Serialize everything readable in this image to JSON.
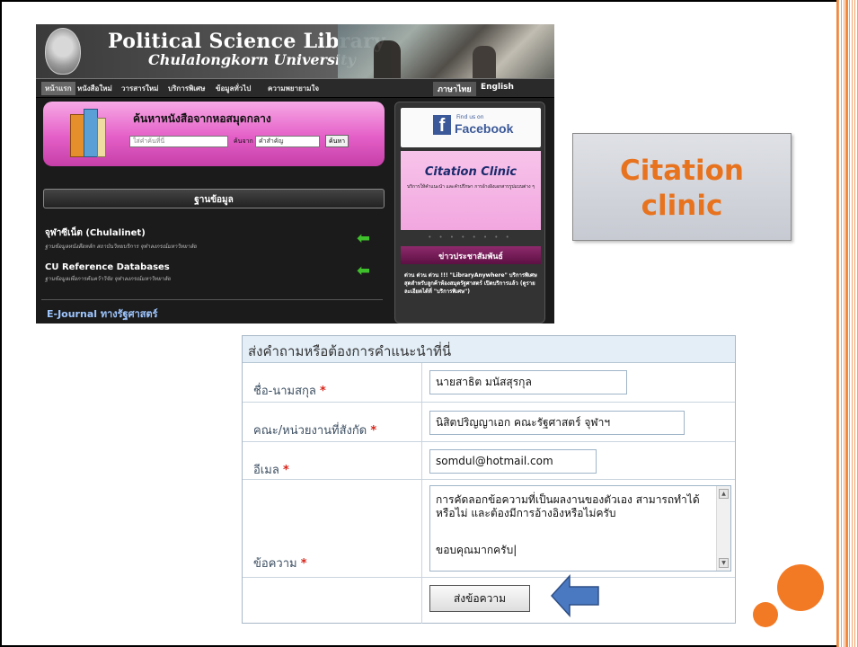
{
  "site": {
    "title": "Political Science Library",
    "subtitle": "Chulalongkorn University",
    "nav": [
      "หน้าแรก",
      "หนังสือใหม่",
      "วารสารใหม่",
      "บริการพิเศษ",
      "ข้อมูลทั่วไป",
      "ความพยายามใจ"
    ],
    "lang_thai": "ภาษาไทย",
    "lang_english": "English",
    "search": {
      "title": "ค้นหาหนังสือจากหอสมุดกลาง",
      "placeholder": "ใส่คำค้นที่นี่",
      "from_label": "ค้นจาก",
      "select_value": "คำสำคัญ",
      "button": "ค้นหา"
    },
    "database_heading": "ฐานข้อมูล",
    "db_items": [
      {
        "title": "จุฬาซีเน็ต (Chulalinet)",
        "desc": "ฐานข้อมูลหนังสือหลัก สถาบันวิทยบริการ จุฬาลงกรณ์มหาวิทยาลัย"
      },
      {
        "title": "CU Reference Databases",
        "desc": "ฐานข้อมูลเพื่อการค้นคว้าวิจัย จุฬาลงกรณ์มหาวิทยาลัย"
      }
    ],
    "ejournal": "E-Journal ทางรัฐศาสตร์",
    "facebook": {
      "find": "Find us on",
      "name": "Facebook"
    },
    "citation_banner": {
      "title": "Citation Clinic",
      "desc": "บริการให้คำแนะนำ และคำปรึกษา การอ้างอิงเอกสารรูปแบบต่าง ๆ"
    },
    "news_heading": "ข่าวประชาสัมพันธ์",
    "news_text": "ด่วน ด่วน ด่วน !!! \"LibraryAnywhere\" บริการพิเศษ สุดสำหรับลูกค้าห้องสมุดรัฐศาสตร์ เปิดบริการแล้ว (ดูรายละเอียดได้ที่ \"บริการพิเศษ\")"
  },
  "callout": {
    "line1": "Citation",
    "line2": "clinic"
  },
  "form": {
    "heading": "ส่งคำถามหรือต้องการคำแนะนำที่นี่",
    "name_label": "ชื่อ-นามสกุล",
    "name_value": "นายสาธิต มนัสสุรกุล",
    "faculty_label": "คณะ/หน่วยงานที่สังกัด",
    "faculty_value": "นิสิตปริญญาเอก คณะรัฐศาสตร์ จุฬาฯ",
    "email_label": "อีเมล",
    "email_value": "somdul@hotmail.com",
    "message_label": "ข้อความ",
    "message_value": "การคัดลอกข้อความที่เป็นผลงานของตัวเอง สามารถทำได้หรือไม่ และต้องมีการอ้างอิงหรือไม่ครับ",
    "message_thanks": "ขอบคุณมากครับ",
    "required_mark": "*",
    "submit": "ส่งข้อความ"
  },
  "colors": {
    "accent_orange": "#f37a25",
    "callout_text": "#e8731f",
    "form_header_bg": "#e3eef7",
    "required": "#d8251a",
    "arrow_blue": "#4a79c2"
  }
}
